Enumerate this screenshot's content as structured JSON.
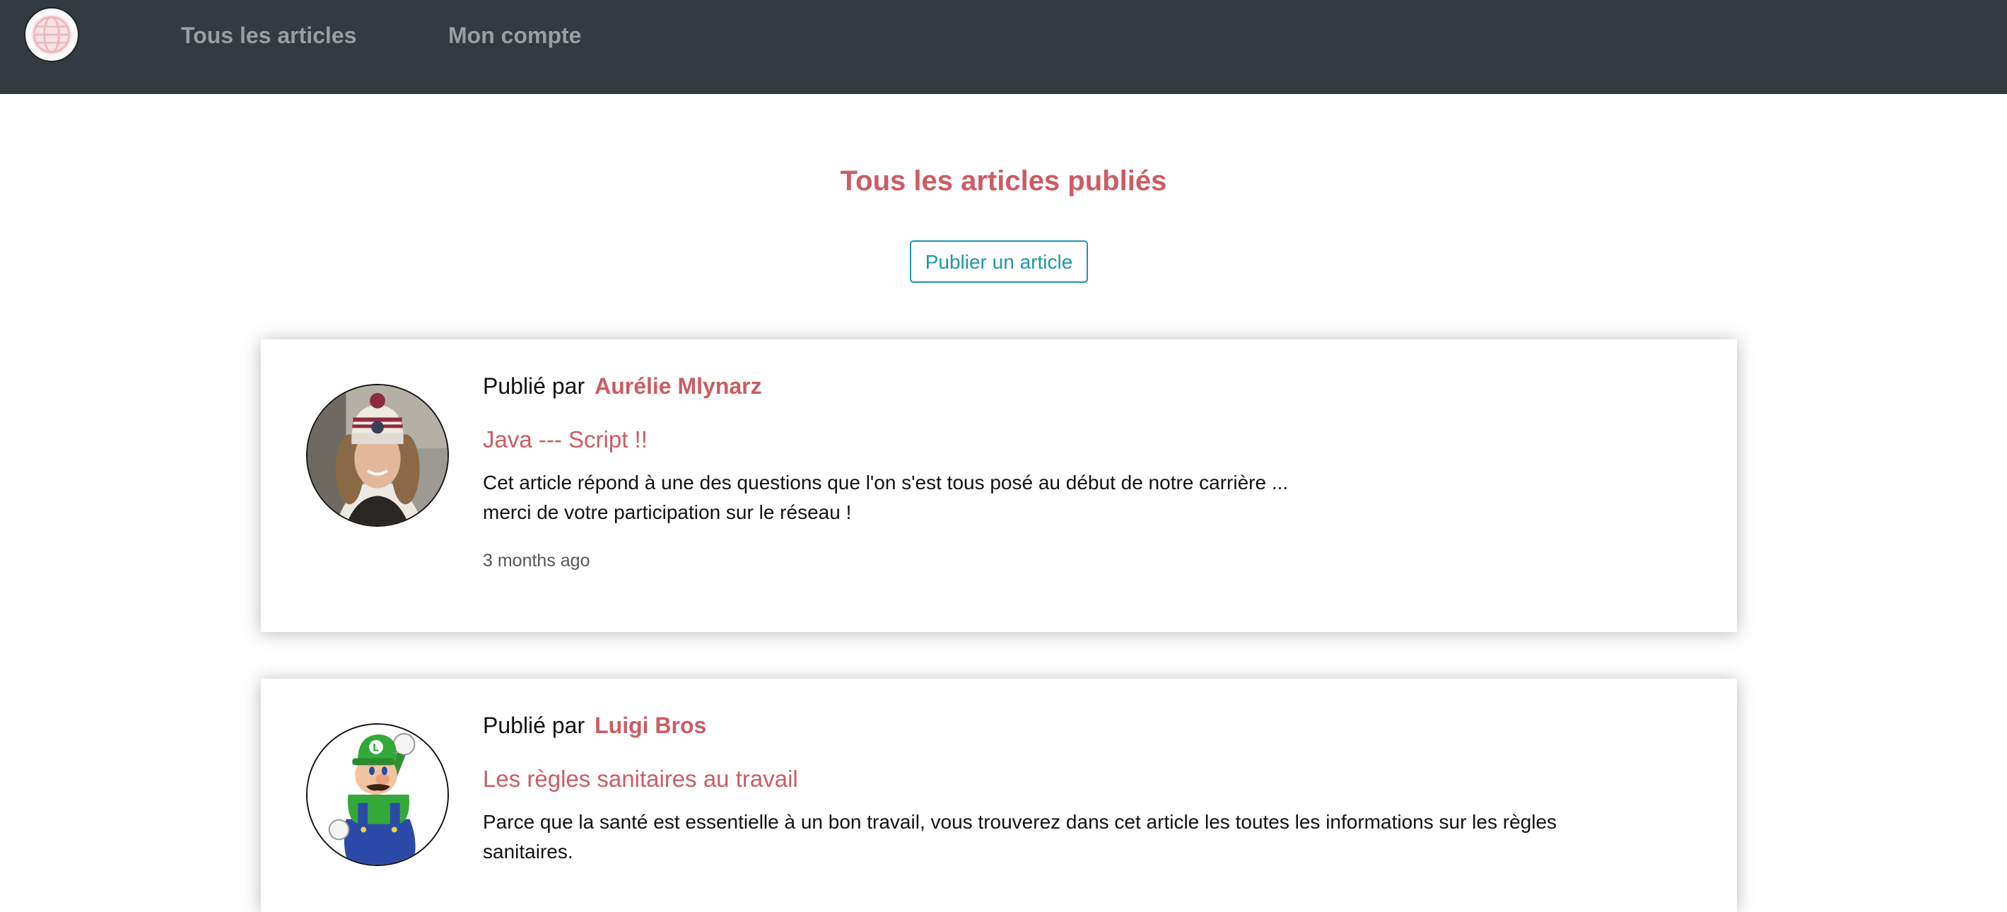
{
  "nav": {
    "logo_icon": "globe-icon",
    "links": [
      {
        "label": "Tous les articles"
      },
      {
        "label": "Mon compte"
      }
    ]
  },
  "main": {
    "title": "Tous les articles publiés",
    "publish_button": "Publier un article"
  },
  "posts": [
    {
      "byline_prefix": "Publié par",
      "author": "Aurélie Mlynarz",
      "avatar": "woman-in-beanie-photo",
      "title": "Java --- Script !!",
      "excerpt_lines": [
        "Cet article répond à une des questions que l'on s'est tous posé au début de notre carrière ...",
        "merci de votre participation sur le réseau !"
      ],
      "time": "3 months ago"
    },
    {
      "byline_prefix": "Publié par",
      "author": "Luigi Bros",
      "avatar": "luigi-character-image",
      "title": "Les règles sanitaires au travail",
      "excerpt_lines": [
        "Parce que la santé est essentielle à un bon travail, vous trouverez dans cet article les toutes les informations sur les règles",
        "sanitaires."
      ]
    }
  ],
  "colors": {
    "navbar": "#343a40",
    "nav_link": "#9a9da1",
    "accent": "#cc5c63",
    "button": "#1d97a8"
  }
}
